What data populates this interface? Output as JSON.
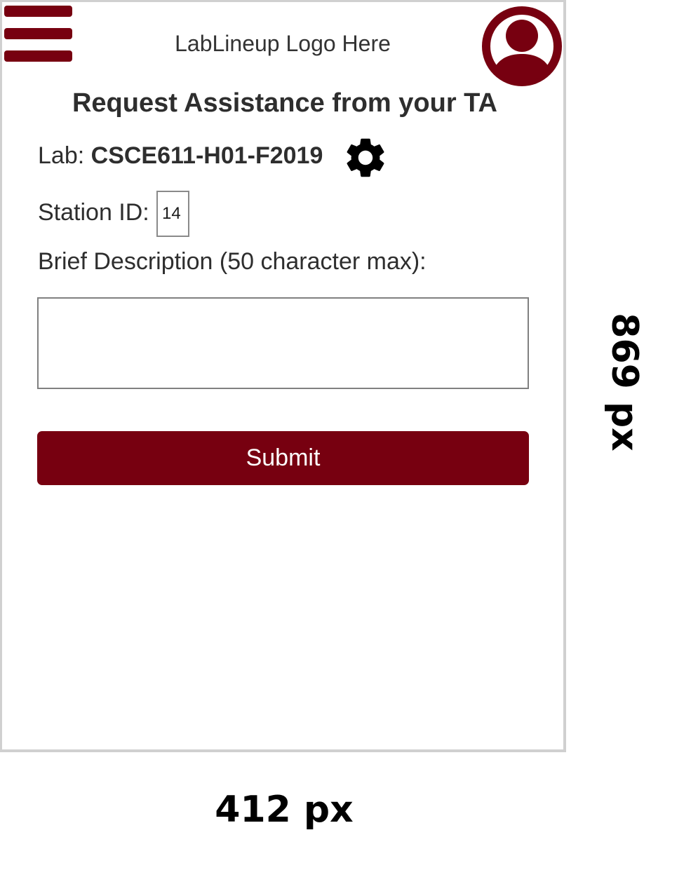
{
  "header": {
    "logo_text": "LabLineup Logo Here",
    "menu_icon": "hamburger-menu-icon",
    "profile_icon": "user-avatar-icon"
  },
  "page": {
    "title": "Request Assistance from your TA"
  },
  "lab": {
    "label": "Lab:",
    "id": "CSCE611-H01-F2019",
    "settings_icon": "gear-icon"
  },
  "station": {
    "label": "Station ID:",
    "value": "14"
  },
  "description": {
    "label": "Brief Description (50 character max):",
    "value": ""
  },
  "submit": {
    "label": "Submit"
  },
  "dimensions": {
    "height_label": "869 px",
    "width_label": "412 px"
  },
  "colors": {
    "brand": "#770010",
    "text": "#2e2e2e",
    "frame": "#d0d0d0"
  }
}
